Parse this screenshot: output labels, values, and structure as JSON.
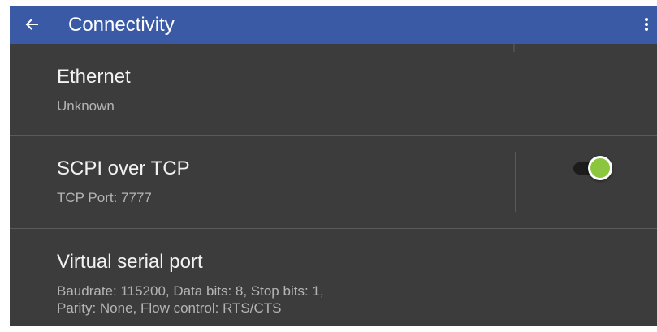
{
  "appbar": {
    "title": "Connectivity",
    "back_icon": "arrow-left-icon",
    "menu_icon": "more-vertical-icon",
    "color": "#3a5aa6"
  },
  "settings": {
    "ethernet": {
      "title": "Ethernet",
      "summary": "Unknown"
    },
    "scpi": {
      "title": "SCPI over TCP",
      "summary": "TCP Port: 7777",
      "toggle_on": true,
      "toggle_color": "#8cc63f"
    },
    "serial": {
      "title": "Virtual serial port",
      "summary_line1": "Baudrate: 115200, Data bits: 8, Stop bits: 1,",
      "summary_line2": "Parity: None, Flow control: RTS/CTS"
    }
  },
  "theme": {
    "background": "#3c3c3c",
    "primary_text": "#f2f2f2",
    "secondary_text": "#b4b4b4",
    "divider": "#5a5a5a"
  }
}
